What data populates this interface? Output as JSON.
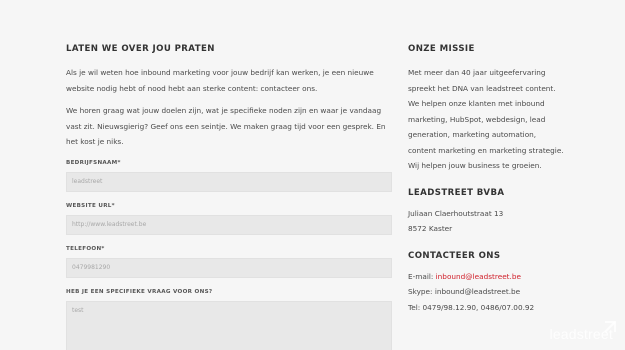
{
  "left": {
    "title": "LATEN WE OVER JOU PRATEN",
    "paragraph1_line1": "Als je wil weten hoe inbound marketing voor jouw bedrijf kan werken, je een nieuwe",
    "paragraph1_line2": "website nodig hebt of nood hebt aan sterke content: contacteer ons.",
    "paragraph2_line1": "We horen graag wat jouw doelen zijn, wat je specifieke noden zijn en waar je vandaag",
    "paragraph2_line2": "vast zit. Nieuwsgierig? Geef ons een seintje. We maken graag tijd voor een gesprek. En",
    "paragraph2_line3": "het kost je niks."
  },
  "form": {
    "company_label": "BEDRIJFSNAAM*",
    "company_value": "leadstreet",
    "website_label": "WEBSITE URL*",
    "website_value": "http://www.leadstreet.be",
    "phone_label": "TELEFOON*",
    "phone_value": "0479981290",
    "question_label": "HEB JE EEN SPECIFIEKE VRAAG VOOR ONS?",
    "question_value": "test"
  },
  "right": {
    "mission_title": "ONZE MISSIE",
    "mission_lines": [
      "Met meer dan 40 jaar uitgeefervaring",
      "spreekt het DNA van leadstreet content.",
      "We helpen onze klanten met inbound",
      "marketing, HubSpot, webdesign, lead",
      "generation, marketing automation,",
      "content marketing en marketing strategie.",
      "Wij helpen jouw business te groeien."
    ],
    "company_title": "LEADSTREET BVBA",
    "address_line1": "Juliaan Claerhoutstraat 13",
    "address_line2": "8572 Kaster",
    "contact_title": "CONTACTEER ONS",
    "email_label": "E-mail: ",
    "email_value": "inbound@leadstreet.be",
    "skype_text": "Skype: inbound@leadstreet.be",
    "tel_text": "Tel: 0479/98.12.90, 0486/07.00.92"
  },
  "watermark": {
    "text": "leadstreet"
  },
  "colors": {
    "background": "#f6f6f6",
    "accent": "#d0202b",
    "input_bg": "#e8e8e8"
  }
}
